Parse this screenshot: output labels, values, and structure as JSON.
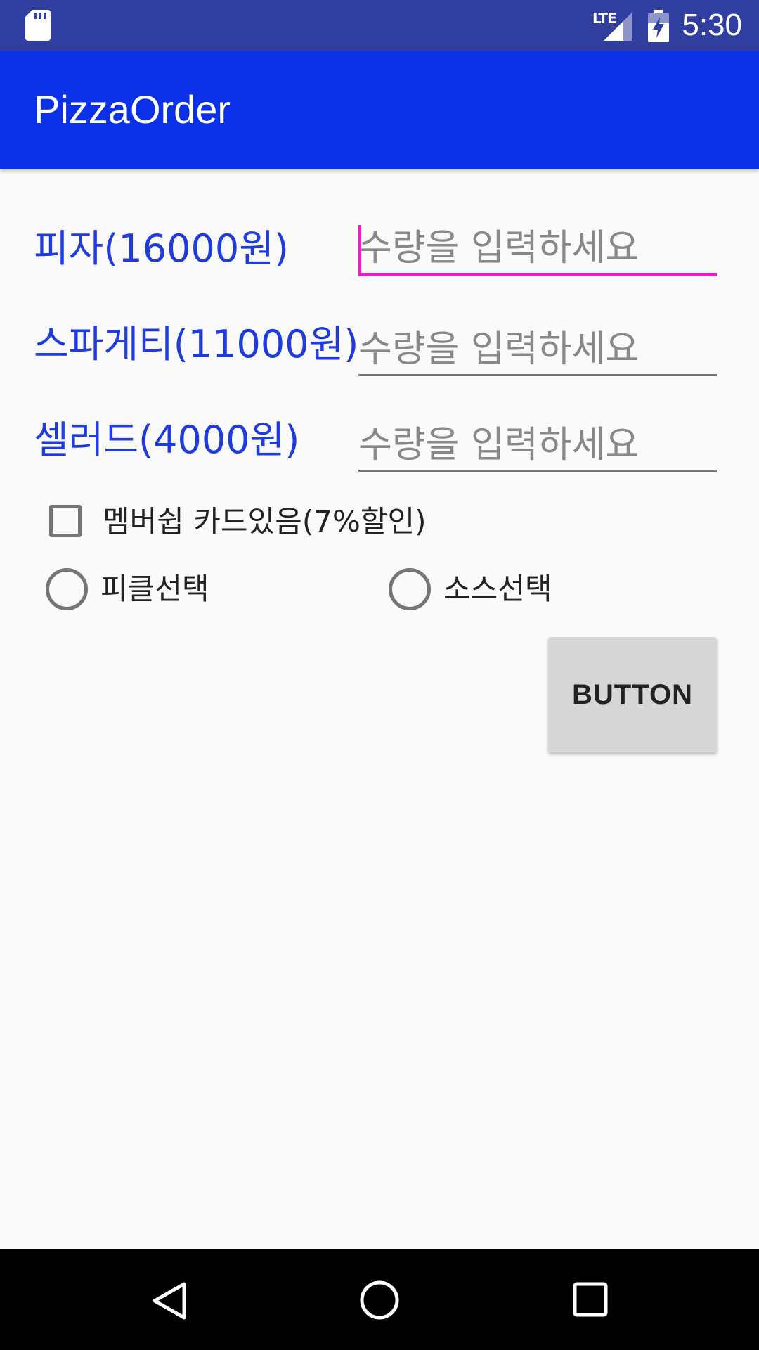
{
  "status_bar": {
    "time": "5:30",
    "network_label": "LTE",
    "icons": [
      "sd-card-icon",
      "signal-icon",
      "battery-charging-icon"
    ]
  },
  "app_bar": {
    "title": "PizzaOrder",
    "color": "#0a30e8"
  },
  "form": {
    "items": [
      {
        "label": "피자(16000원)",
        "placeholder": "수량을 입력하세요",
        "value": ""
      },
      {
        "label": "스파게티(11000원)",
        "placeholder": "수량을 입력하세요",
        "value": ""
      },
      {
        "label": "셀러드(4000원)",
        "placeholder": "수량을 입력하세요",
        "value": ""
      }
    ],
    "membership_checkbox": {
      "label": "멤버쉽 카드있음(7%할인)",
      "checked": false
    },
    "radios": [
      {
        "label": "피클선택",
        "selected": false
      },
      {
        "label": "소스선택",
        "selected": false
      }
    ],
    "button_label": "BUTTON"
  },
  "nav_bar": {
    "icons": [
      "back-icon",
      "home-icon",
      "recents-icon"
    ]
  },
  "colors": {
    "status_bar": "#303f9f",
    "label_text": "#1f3be0",
    "focus_accent": "#e81fcf"
  }
}
